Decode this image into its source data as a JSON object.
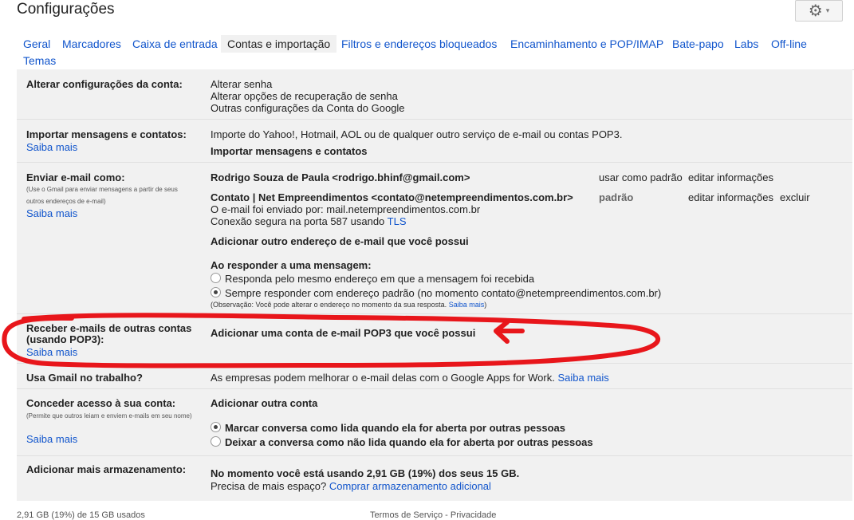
{
  "header": {
    "title": "Configurações",
    "gear_icon": "gear-icon",
    "caret": "▾"
  },
  "tabs": [
    {
      "label": "Geral"
    },
    {
      "label": "Marcadores"
    },
    {
      "label": "Caixa de entrada"
    },
    {
      "label": "Contas e importação"
    },
    {
      "label": "Filtros e endereços bloqueados"
    },
    {
      "label": "Encaminhamento e POP/IMAP"
    },
    {
      "label": "Bate-papo"
    },
    {
      "label": "Labs"
    },
    {
      "label": "Off-line"
    },
    {
      "label": "Temas"
    }
  ],
  "sections": {
    "alterar": {
      "label": "Alterar configurações da conta:",
      "links": [
        "Alterar senha",
        "Alterar opções de recuperação de senha",
        "Outras configurações da Conta do Google"
      ]
    },
    "importar": {
      "label": "Importar mensagens e contatos:",
      "saiba": "Saiba mais",
      "desc": "Importe do Yahoo!, Hotmail, AOL ou de qualquer outro serviço de e-mail ou contas POP3.",
      "action": "Importar mensagens e contatos"
    },
    "enviar": {
      "label": "Enviar e-mail como:",
      "sub": "(Use o Gmail para enviar mensagens a partir de seus outros endereços de e-mail)",
      "saiba": "Saiba mais",
      "account1": {
        "name": "Rodrigo Souza de Paula <rodrigo.bhinf@gmail.com>",
        "default_link": "usar como padrão",
        "edit": "editar informações"
      },
      "account2": {
        "name": "Contato | Net Empreendimentos <contato@netempreendimentos.com.br>",
        "default_label": "padrão",
        "edit": "editar informações",
        "delete": "excluir",
        "sent_via": "O e-mail foi enviado por: mail.netempreendimentos.com.br",
        "secure_prefix": "Conexão segura na porta 587 usando",
        "tls": "TLS"
      },
      "add_other": "Adicionar outro endereço de e-mail que você possui",
      "reply_heading": "Ao responder a uma mensagem:",
      "reply_opt1": "Responda pelo mesmo endereço em que a mensagem foi recebida",
      "reply_opt2": "Sempre responder com endereço padrão (no momento contato@netempreendimentos.com.br)",
      "note": "(Observação: Você pode alterar o endereço no momento da sua resposta.",
      "note_link": "Saiba mais",
      "note_end": ")"
    },
    "receber": {
      "label1": "Receber e-mails de outras contas",
      "label2": "(usando POP3):",
      "saiba": "Saiba mais",
      "action": "Adicionar uma conta de e-mail POP3 que você possui"
    },
    "trabalho": {
      "label": "Usa Gmail no trabalho?",
      "desc": "As empresas podem melhorar o e-mail delas com o Google Apps for Work.",
      "saiba": "Saiba mais"
    },
    "acesso": {
      "label": "Conceder acesso à sua conta:",
      "sub": "(Permite que outros leiam e enviem e-mails em seu nome)",
      "saiba": "Saiba mais",
      "action": "Adicionar outra conta",
      "opt1": "Marcar conversa como lida quando ela for aberta por outras pessoas",
      "opt2": "Deixar a conversa como não lida quando ela for aberta por outras pessoas"
    },
    "armazenamento": {
      "label": "Adicionar mais armazenamento:",
      "usage": "No momento você está usando 2,91 GB (19%) dos seus 15 GB.",
      "need": "Precisa de mais espaço?",
      "buy": "Comprar armazenamento adicional"
    }
  },
  "footer": {
    "usage": "2,91 GB (19%) de 15 GB usados",
    "terms": "Termos de Serviço",
    "sep": "-",
    "privacy": "Privacidade"
  },
  "annotation_color": "#e8161b"
}
